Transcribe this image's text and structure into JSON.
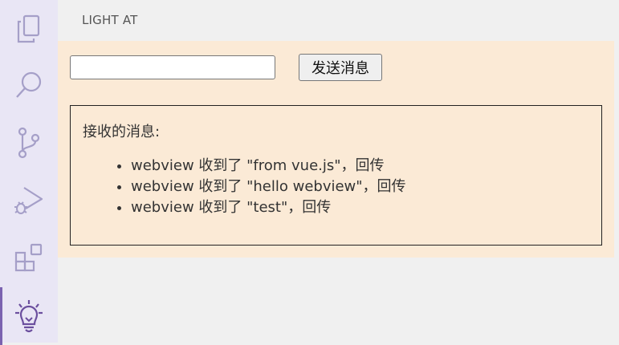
{
  "activity_bar": {
    "items": [
      {
        "name": "explorer-icon"
      },
      {
        "name": "search-icon"
      },
      {
        "name": "source-control-icon"
      },
      {
        "name": "run-debug-icon"
      },
      {
        "name": "extensions-icon"
      },
      {
        "name": "lightbulb-icon",
        "active": true
      }
    ],
    "accent_color": "#7b63b0"
  },
  "sidebar": {
    "title": "LIGHT AT"
  },
  "panel": {
    "background": "#fbead6",
    "input": {
      "value": "",
      "placeholder": ""
    },
    "send_button_label": "发送消息",
    "messages_title": "接收的消息:",
    "messages": [
      "webview 收到了 \"from vue.js\"，回传",
      "webview 收到了 \"hello webview\"，回传",
      "webview 收到了 \"test\"，回传"
    ]
  }
}
